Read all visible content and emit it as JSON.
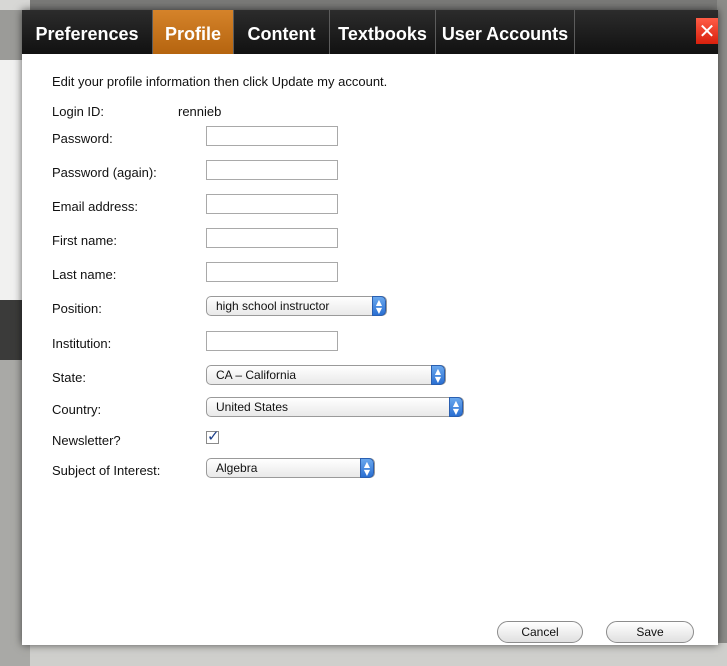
{
  "tabs": [
    {
      "label": "Preferences"
    },
    {
      "label": "Profile"
    },
    {
      "label": "Content"
    },
    {
      "label": "Textbooks"
    },
    {
      "label": "User Accounts"
    }
  ],
  "active_tab": "Profile",
  "close_glyph": "✕",
  "instruction": "Edit your profile information then click Update my account.",
  "form": {
    "login_id": {
      "label": "Login ID:",
      "value": "rennieb"
    },
    "password": {
      "label": "Password:",
      "value": ""
    },
    "password_again": {
      "label": "Password (again):",
      "value": ""
    },
    "email": {
      "label": "Email address:",
      "value": ""
    },
    "first_name": {
      "label": "First name:",
      "value": ""
    },
    "last_name": {
      "label": "Last name:",
      "value": ""
    },
    "position": {
      "label": "Position:",
      "value": "high school instructor"
    },
    "institution": {
      "label": "Institution:",
      "value": ""
    },
    "state": {
      "label": "State:",
      "value": "CA – California"
    },
    "country": {
      "label": "Country:",
      "value": "United States"
    },
    "newsletter": {
      "label": "Newsletter?",
      "checked": true
    },
    "subject": {
      "label": "Subject of Interest:",
      "value": "Algebra"
    }
  },
  "buttons": {
    "cancel": "Cancel",
    "save": "Save"
  },
  "icons": {
    "close": "close-icon",
    "select_arrow": "chevron-updown-icon",
    "check": "checkmark-icon"
  },
  "colors": {
    "tab_bar": "#1a1a1a",
    "active_tab": "#c8741c",
    "close_button": "#e8301a",
    "select_arrow": "#3a7fdc"
  }
}
